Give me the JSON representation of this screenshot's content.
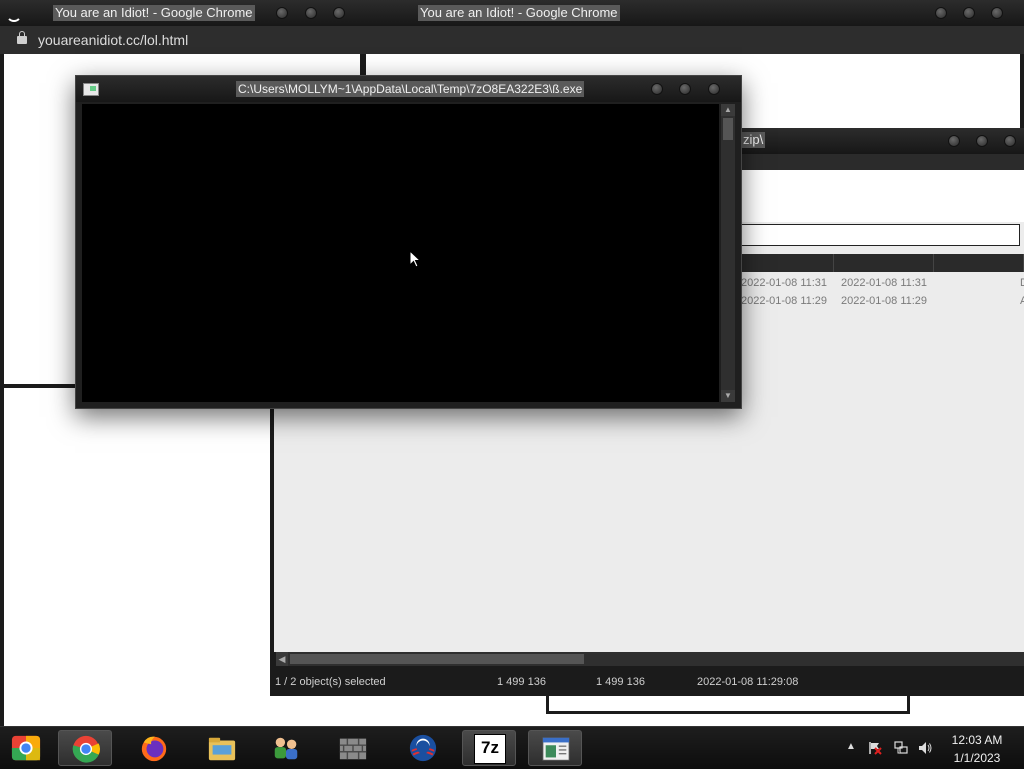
{
  "windows": {
    "chrome1": {
      "title": "You are an Idiot! - Google Chrome",
      "url": "youareanidiot.cc/lol.html"
    },
    "chrome2": {
      "title": "You are an Idiot! - Google Chrome"
    },
    "console": {
      "title": "C:\\Users\\MOLLYM~1\\AppData\\Local\\Temp\\7zO8EA322E3\\ß.exe"
    },
    "sevenzip": {
      "title_fragment": "zip\\",
      "files": [
        {
          "modified": "2022-01-08 11:31",
          "created": "2022-01-08 11:31",
          "attr": "D"
        },
        {
          "modified": "2022-01-08 11:29",
          "created": "2022-01-08 11:29",
          "attr": "A"
        }
      ],
      "status": {
        "selection": "1 / 2 object(s) selected",
        "size": "1 499 136",
        "packed": "1 499 136",
        "date": "2022-01-08 11:29:08"
      }
    }
  },
  "taskbar": {
    "items": [
      {
        "name": "chrome-orb-start-icon"
      },
      {
        "name": "google-chrome-icon",
        "active": true
      },
      {
        "name": "firefox-icon"
      },
      {
        "name": "file-explorer-icon"
      },
      {
        "name": "network-users-icon"
      },
      {
        "name": "firewall-icon"
      },
      {
        "name": "obama-logo-icon"
      },
      {
        "name": "seven-zip-icon",
        "label": "7z",
        "active": true
      },
      {
        "name": "console-window-icon",
        "active": true
      }
    ],
    "clock": {
      "time": "12:03 AM",
      "date": "1/1/2023"
    }
  }
}
